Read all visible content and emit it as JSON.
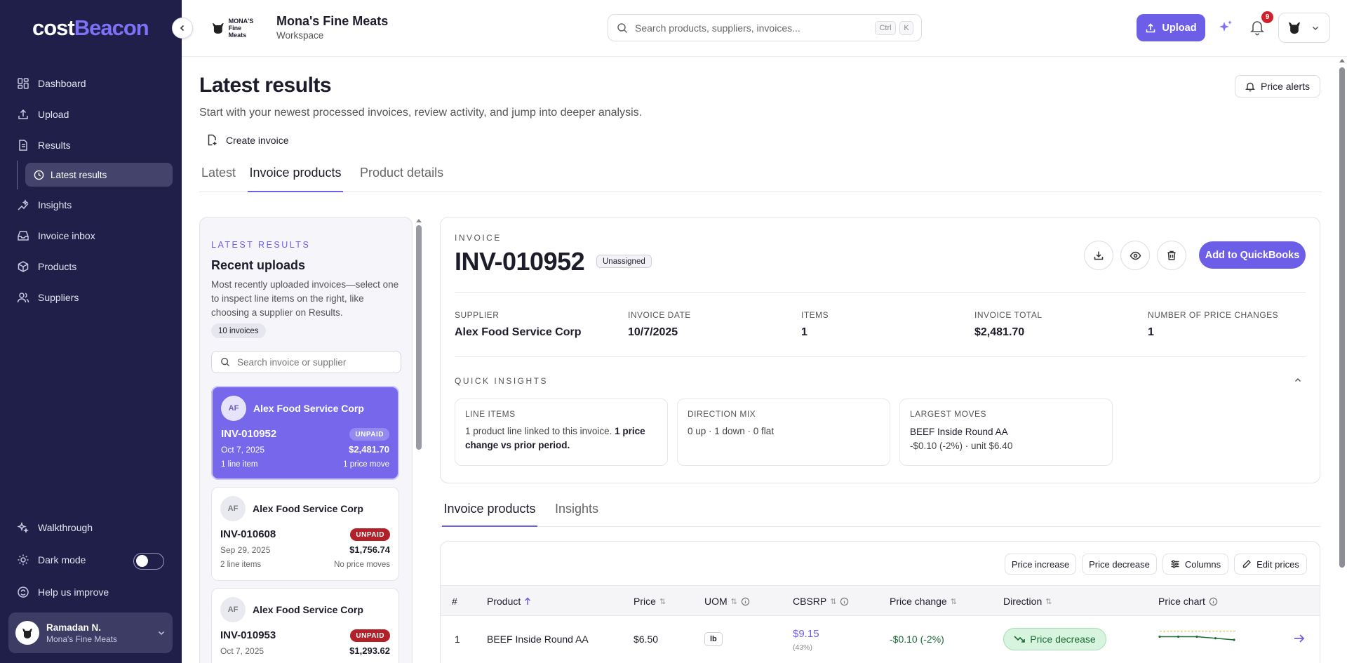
{
  "sidebar": {
    "brand_a": "cost",
    "brand_b": "Beacon",
    "items": [
      {
        "label": "Dashboard",
        "icon": "dashboard-icon"
      },
      {
        "label": "Upload",
        "icon": "upload-icon"
      },
      {
        "label": "Results",
        "icon": "results-icon"
      },
      {
        "label": "Latest results",
        "icon": "clock-icon"
      },
      {
        "label": "Insights",
        "icon": "insights-icon"
      },
      {
        "label": "Invoice inbox",
        "icon": "inbox-icon"
      },
      {
        "label": "Products",
        "icon": "box-icon"
      },
      {
        "label": "Suppliers",
        "icon": "users-icon"
      }
    ],
    "bottom": {
      "walkthrough": "Walkthrough",
      "dark_mode": "Dark mode",
      "help": "Help us improve"
    },
    "user": {
      "name": "Ramadan N.",
      "org": "Mona's Fine Meats"
    }
  },
  "topbar": {
    "workspace_name": "Mona's Fine Meats",
    "workspace_sub": "Workspace",
    "logo_text": "MONA'S Fine Meats",
    "search_placeholder": "Search products, suppliers, invoices...",
    "kbd_ctrl": "Ctrl",
    "kbd_k": "K",
    "upload_label": "Upload",
    "notification_count": "9"
  },
  "page": {
    "title": "Latest results",
    "subtitle": "Start with your newest processed invoices, review activity, and jump into deeper analysis.",
    "create_invoice": "Create invoice",
    "price_alerts": "Price alerts",
    "tabs": [
      "Latest",
      "Invoice products",
      "Product details"
    ]
  },
  "recent": {
    "eyebrow": "LATEST RESULTS",
    "title": "Recent uploads",
    "description": "Most recently uploaded invoices—select one to inspect line items on the right, like choosing a supplier on Results.",
    "count": "10 invoices",
    "search_placeholder": "Search invoice or supplier",
    "cards": [
      {
        "initials": "AF",
        "supplier": "Alex Food Service Corp",
        "id": "INV-010952",
        "status": "UNPAID",
        "date": "Oct 7, 2025",
        "amount": "$2,481.70",
        "lines": "1 line item",
        "moves": "1 price move"
      },
      {
        "initials": "AF",
        "supplier": "Alex Food Service Corp",
        "id": "INV-010608",
        "status": "UNPAID",
        "date": "Sep 29, 2025",
        "amount": "$1,756.74",
        "lines": "2 line items",
        "moves": "No price moves"
      },
      {
        "initials": "AF",
        "supplier": "Alex Food Service Corp",
        "id": "INV-010953",
        "status": "UNPAID",
        "date": "Oct 7, 2025",
        "amount": "$1,293.62",
        "lines": "",
        "moves": ""
      }
    ]
  },
  "invoice": {
    "eyebrow": "INVOICE",
    "id": "INV-010952",
    "assign_status": "Unassigned",
    "qb_label": "Add to QuickBooks",
    "meta": [
      {
        "label": "SUPPLIER",
        "value": "Alex Food Service Corp"
      },
      {
        "label": "INVOICE DATE",
        "value": "10/7/2025"
      },
      {
        "label": "ITEMS",
        "value": "1"
      },
      {
        "label": "INVOICE TOTAL",
        "value": "$2,481.70"
      },
      {
        "label": "NUMBER OF PRICE CHANGES",
        "value": "1"
      }
    ],
    "quick_insights_title": "QUICK INSIGHTS",
    "insights": {
      "line_items_label": "LINE ITEMS",
      "line_items_text": "1 product line linked to this invoice.",
      "line_items_bold": "1 price change vs prior period.",
      "direction_label": "DIRECTION MIX",
      "direction_text": "0 up · 1 down · 0 flat",
      "largest_label": "LARGEST MOVES",
      "largest_product": "BEEF Inside Round AA",
      "largest_detail": "-$0.10 (-2%) · unit $6.40"
    }
  },
  "subtabs": [
    "Invoice products",
    "Insights"
  ],
  "table": {
    "toolbar": {
      "price_increase": "Price increase",
      "price_decrease": "Price decrease",
      "columns": "Columns",
      "edit_prices": "Edit prices"
    },
    "headers": {
      "num": "#",
      "product": "Product",
      "price": "Price",
      "uom": "UOM",
      "cbsrp": "CBSRP",
      "price_change": "Price change",
      "direction": "Direction",
      "price_chart": "Price chart"
    },
    "rows": [
      {
        "num": "1",
        "product": "BEEF Inside Round AA",
        "price": "$6.50",
        "uom": "lb",
        "cbsrp": "$9.15",
        "cbsrp_pct": "(43%)",
        "price_change": "-$0.10 (-2%)",
        "direction": "Price decrease",
        "spark": [
          6.6,
          6.6,
          6.6,
          6.55,
          6.5
        ]
      }
    ]
  },
  "colors": {
    "accent": "#6d5ee8",
    "sidebar": "#201f4a",
    "unpaid": "#b32028",
    "decrease": "#1b6c35"
  }
}
